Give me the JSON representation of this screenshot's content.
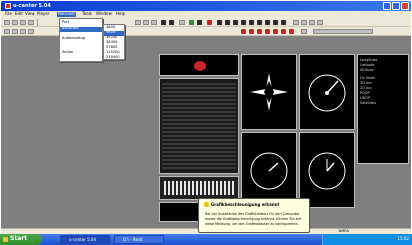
{
  "window": {
    "title": "u-center 5.04"
  },
  "menu": {
    "items": [
      "File",
      "Edit",
      "View",
      "Player",
      "Receiver",
      "Tools",
      "Window",
      "Help"
    ],
    "active_index": 4
  },
  "receiver_menu": {
    "items": [
      "Port",
      "Baudrate",
      "Autobauding",
      "Action"
    ],
    "baudrate_options": [
      "4800",
      "9600",
      "19200",
      "38400",
      "57600",
      "115200",
      "230400"
    ],
    "baudrate_selected": "9600"
  },
  "tooltip": {
    "title": "Grafikbeschleunigung erkannt",
    "body": "Bei der Installation des Grafiktreibers für den Computer wurde die Grafikbeschleunigung erkannt. Klicken Sie auf diese Meldung, um den Grafikadapter zu konfigurieren."
  },
  "statusbar": {
    "right_text": "NMEA"
  },
  "taskbar": {
    "start": "Start",
    "buttons": [
      "u-center 5.04",
      "D:\\ - Paint"
    ],
    "clock": "15:02"
  },
  "right_panel": {
    "labels": [
      "Longitude",
      "Latitude",
      "Altitude",
      "Fix Mode",
      "3D Acc",
      "2D Acc",
      "PDOP",
      "HDOP",
      "Satellites"
    ]
  },
  "colors": {
    "titlebar": "#0a3bd2",
    "menu_active": "#316ac5",
    "workspace": "#7f7f7f",
    "taskbar": "#245edb"
  }
}
